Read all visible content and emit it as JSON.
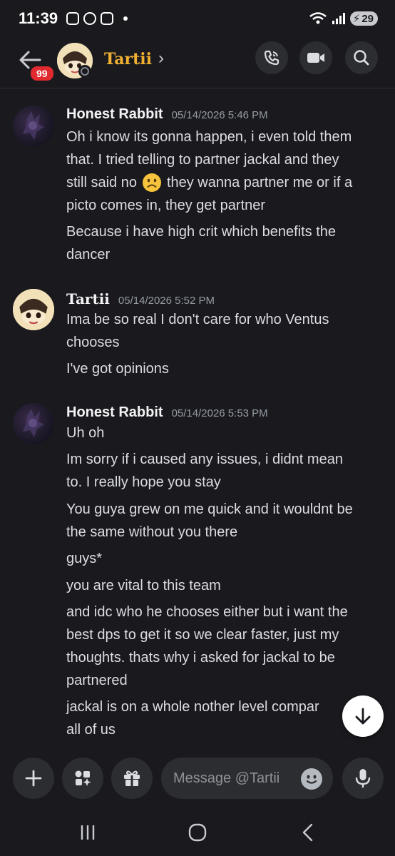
{
  "status_bar": {
    "time": "11:39",
    "battery": "29"
  },
  "header": {
    "unread_badge": "99",
    "name": "Tartii",
    "chevron": "›",
    "colors": {
      "name": "#f0b132",
      "badge": "#e02a2f"
    }
  },
  "messages": [
    {
      "author": "Honest Rabbit",
      "timestamp": "05/14/2026 5:46 PM",
      "lines": [
        "Oh i know its gonna happen, i even told them",
        "that. I tried telling to partner jackal and they",
        "still said no",
        "they wanna partner me or if a",
        "picto comes in, they get partner",
        "Because i have high crit which benefits the",
        "dancer"
      ]
    },
    {
      "author": "Tartii",
      "timestamp": "05/14/2026 5:52 PM",
      "lines": [
        "Ima be so real I don't care for who Ventus",
        "chooses",
        "I've got opinions"
      ]
    },
    {
      "author": "Honest Rabbit",
      "timestamp": "05/14/2026 5:53 PM",
      "lines": [
        "Uh oh",
        "Im sorry if i caused any issues, i didnt mean",
        "to. I really hope you stay",
        "You guya grew on me quick and it wouldnt be",
        "the same without you there",
        "guys*",
        "you are vital to this team",
        "and idc who he chooses either but i want the",
        "best dps to get it so we clear faster, just my",
        "thoughts. thats why i asked for jackal to be",
        "partnered",
        "jackal is on a whole nother level compar",
        "all of us"
      ]
    }
  ],
  "composer": {
    "placeholder": "Message @Tartii"
  }
}
